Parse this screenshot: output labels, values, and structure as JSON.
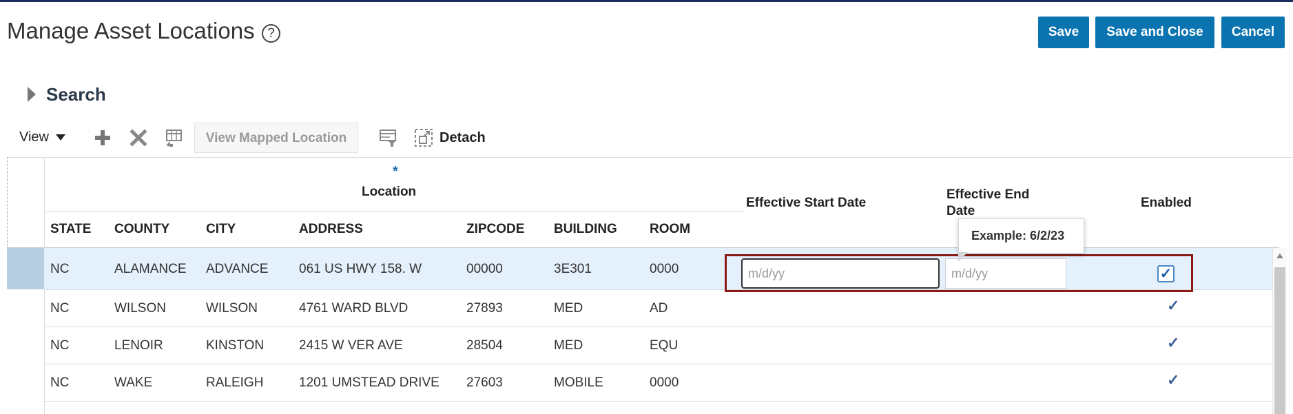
{
  "header": {
    "title": "Manage Asset Locations",
    "help_symbol": "?",
    "save_label": "Save",
    "save_close_label": "Save and Close",
    "cancel_label": "Cancel"
  },
  "search": {
    "label": "Search"
  },
  "toolbar": {
    "view_label": "View",
    "add_icon": "plus-icon",
    "delete_icon": "x-icon",
    "columns_icon": "table-columns-icon",
    "view_mapped_location_label": "View Mapped Location",
    "filter_icon": "filter-icon",
    "detach_icon": "detach-icon",
    "detach_label": "Detach"
  },
  "table": {
    "group_header": "Location",
    "required_marker": "*",
    "columns": [
      "STATE",
      "COUNTY",
      "CITY",
      "ADDRESS",
      "ZIPCODE",
      "BUILDING",
      "ROOM"
    ],
    "effective_start_header": "Effective Start Date",
    "effective_end_header": "Effective End Date",
    "enabled_header": "Enabled",
    "date_placeholder": "m/d/yy",
    "tooltip": "Example: 6/2/23",
    "rows": [
      {
        "state": "NC",
        "county": "ALAMANCE",
        "city": "ADVANCE",
        "address": "061 US HWY 158. W",
        "zipcode": "00000",
        "building": "3E301",
        "room": "0000",
        "enabled": "✓"
      },
      {
        "state": "NC",
        "county": "WILSON",
        "city": "WILSON",
        "address": "4761 WARD BLVD",
        "zipcode": "27893",
        "building": "MED",
        "room": "AD",
        "enabled": "✓"
      },
      {
        "state": "NC",
        "county": "LENOIR",
        "city": "KINSTON",
        "address": "2415 W VER AVE",
        "zipcode": "28504",
        "building": "MED",
        "room": "EQU",
        "enabled": "✓"
      },
      {
        "state": "NC",
        "county": "WAKE",
        "city": "RALEIGH",
        "address": "1201 UMSTEAD DRIVE",
        "zipcode": "27603",
        "building": "MOBILE",
        "room": "0000",
        "enabled": "✓"
      }
    ]
  },
  "colors": {
    "accent": "#0b74b0",
    "selected_row": "#e4f0fb",
    "highlight_box": "#8b1a14"
  }
}
